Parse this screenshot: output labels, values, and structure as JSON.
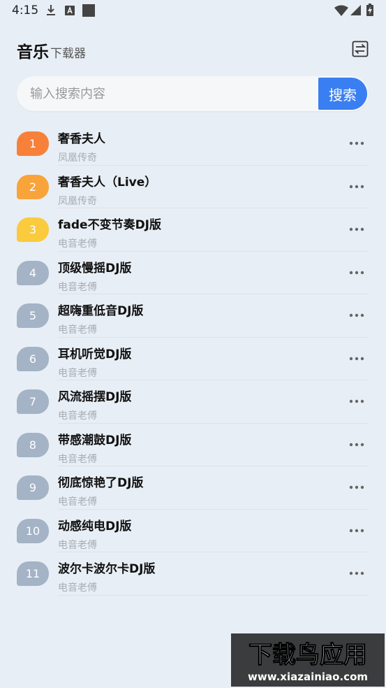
{
  "status_bar": {
    "time": "4:15"
  },
  "header": {
    "title_main": "音乐",
    "title_sub": "下载器"
  },
  "search": {
    "placeholder": "输入搜索内容",
    "button_label": "搜索"
  },
  "songs": [
    {
      "rank": "1",
      "title": "奢香夫人",
      "artist": "凤凰传奇",
      "badge_color": "#f7813a"
    },
    {
      "rank": "2",
      "title": "奢香夫人（Live）",
      "artist": "凤凰传奇",
      "badge_color": "#f8a43b"
    },
    {
      "rank": "3",
      "title": "fade不变节奏DJ版",
      "artist": "电音老傅",
      "badge_color": "#f9cb3d"
    },
    {
      "rank": "4",
      "title": "顶级慢摇DJ版",
      "artist": "电音老傅",
      "badge_color": "#a4b3c6"
    },
    {
      "rank": "5",
      "title": "超嗨重低音DJ版",
      "artist": "电音老傅",
      "badge_color": "#a4b3c6"
    },
    {
      "rank": "6",
      "title": "耳机听觉DJ版",
      "artist": "电音老傅",
      "badge_color": "#a4b3c6"
    },
    {
      "rank": "7",
      "title": "风流摇摆DJ版",
      "artist": "电音老傅",
      "badge_color": "#a4b3c6"
    },
    {
      "rank": "8",
      "title": "带感潮鼓DJ版",
      "artist": "电音老傅",
      "badge_color": "#a4b3c6"
    },
    {
      "rank": "9",
      "title": "彻底惊艳了DJ版",
      "artist": "电音老傅",
      "badge_color": "#a4b3c6"
    },
    {
      "rank": "10",
      "title": "动感纯电DJ版",
      "artist": "电音老傅",
      "badge_color": "#a4b3c6"
    },
    {
      "rank": "11",
      "title": "波尔卡波尔卡DJ版",
      "artist": "电音老傅",
      "badge_color": "#a4b3c6"
    }
  ],
  "watermark": {
    "main": "下载鸟应用",
    "url": "www.xiazainiao.com"
  },
  "colors": {
    "accent": "#3a7ff2",
    "background": "#e8eef5"
  }
}
